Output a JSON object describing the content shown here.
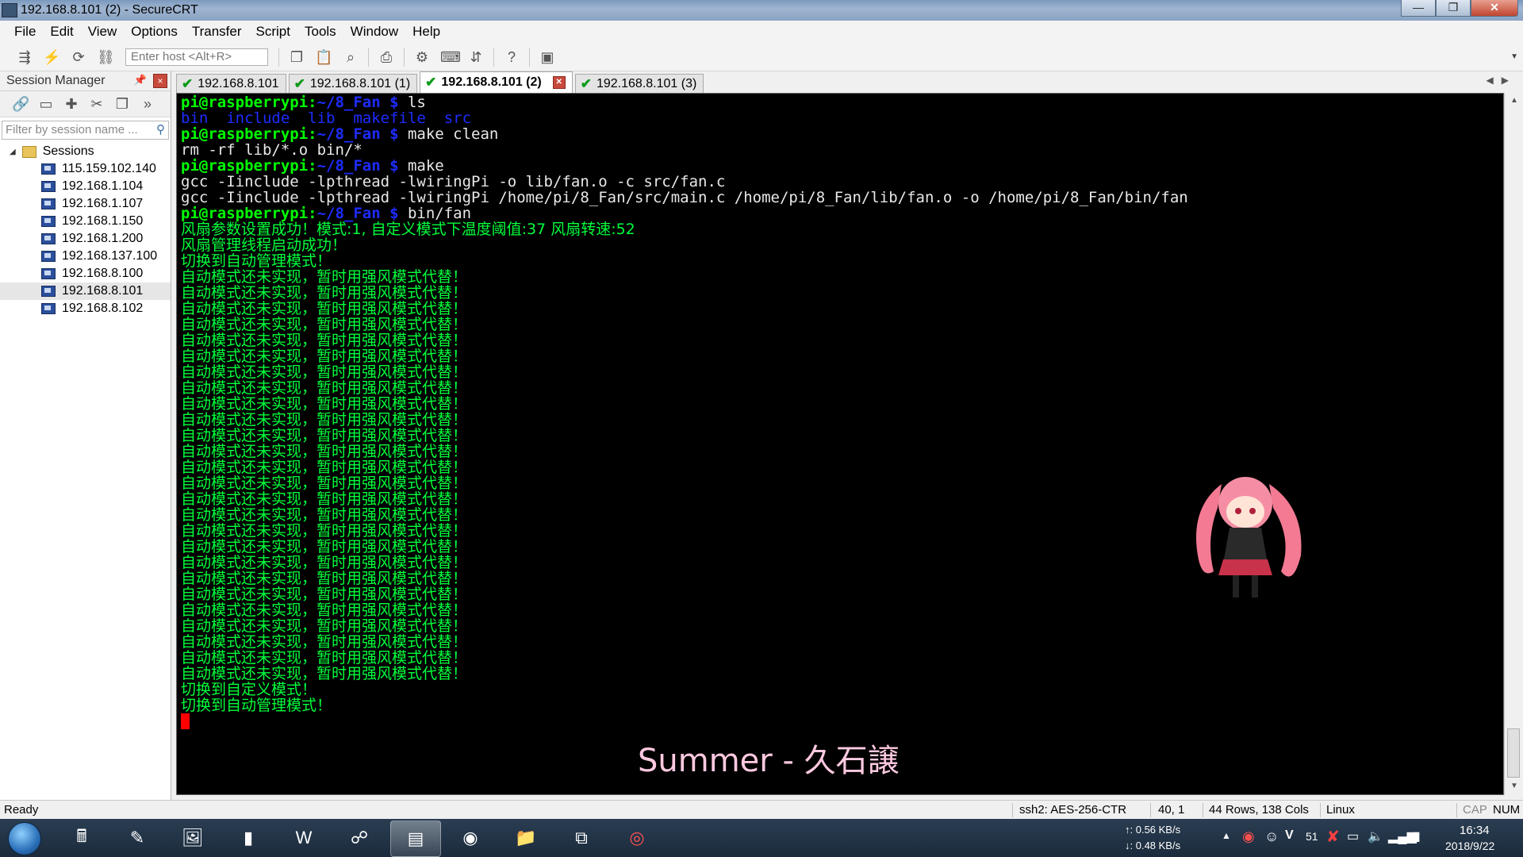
{
  "window": {
    "title": "192.168.8.101 (2) - SecureCRT",
    "controls": [
      "—",
      "❐",
      "✕"
    ]
  },
  "menu": [
    "File",
    "Edit",
    "View",
    "Options",
    "Transfer",
    "Script",
    "Tools",
    "Window",
    "Help"
  ],
  "toolbar": {
    "host_placeholder": "Enter host <Alt+R>",
    "icons": [
      "connect-icon",
      "quick-connect-icon",
      "reconnect-icon",
      "disconnect-icon",
      "copy-icon",
      "paste-icon",
      "find-icon",
      "print-icon",
      "settings-icon",
      "keymap-icon",
      "sftp-icon",
      "help-icon",
      "screenshot-icon"
    ]
  },
  "session_manager": {
    "title": "Session Manager",
    "filter_placeholder": "Filter by session name ...",
    "root": "Sessions",
    "sessions": [
      "115.159.102.140",
      "192.168.1.104",
      "192.168.1.107",
      "192.168.1.150",
      "192.168.1.200",
      "192.168.137.100",
      "192.168.8.100",
      "192.168.8.101",
      "192.168.8.102"
    ],
    "selected": "192.168.8.101"
  },
  "tabs": [
    {
      "label": "192.168.8.101",
      "active": false
    },
    {
      "label": "192.168.8.101 (1)",
      "active": false
    },
    {
      "label": "192.168.8.101 (2)",
      "active": true
    },
    {
      "label": "192.168.8.101 (3)",
      "active": false
    }
  ],
  "terminal": {
    "prompt_user": "pi@raspberrypi:",
    "prompt_path": "~/8_Fan $ ",
    "lines": [
      {
        "type": "prompt",
        "cmd": "ls"
      },
      {
        "type": "ls",
        "text": "bin  include  lib  makefile  src"
      },
      {
        "type": "prompt",
        "cmd": "make clean"
      },
      {
        "type": "out",
        "text": "rm -rf lib/*.o bin/*"
      },
      {
        "type": "prompt",
        "cmd": "make"
      },
      {
        "type": "out",
        "text": "gcc -Iinclude -lpthread -lwiringPi -o lib/fan.o -c src/fan.c"
      },
      {
        "type": "out",
        "text": "gcc -Iinclude -lpthread -lwiringPi /home/pi/8_Fan/src/main.c /home/pi/8_Fan/lib/fan.o -o /home/pi/8_Fan/bin/fan"
      },
      {
        "type": "prompt",
        "cmd": "bin/fan"
      },
      {
        "type": "cjk",
        "text": "风扇参数设置成功！模式:1, 自定义模式下温度阈值:37 风扇转速:52"
      },
      {
        "type": "cjk",
        "text": "风扇管理线程启动成功！"
      },
      {
        "type": "cjk",
        "text": "切换到自动管理模式！"
      },
      {
        "type": "cjk",
        "text": "自动模式还未实现，暂时用强风模式代替！"
      },
      {
        "type": "cjk",
        "text": "自动模式还未实现，暂时用强风模式代替！"
      },
      {
        "type": "cjk",
        "text": "自动模式还未实现，暂时用强风模式代替！"
      },
      {
        "type": "cjk",
        "text": "自动模式还未实现，暂时用强风模式代替！"
      },
      {
        "type": "cjk",
        "text": "自动模式还未实现，暂时用强风模式代替！"
      },
      {
        "type": "cjk",
        "text": "自动模式还未实现，暂时用强风模式代替！"
      },
      {
        "type": "cjk",
        "text": "自动模式还未实现，暂时用强风模式代替！"
      },
      {
        "type": "cjk",
        "text": "自动模式还未实现，暂时用强风模式代替！"
      },
      {
        "type": "cjk",
        "text": "自动模式还未实现，暂时用强风模式代替！"
      },
      {
        "type": "cjk",
        "text": "自动模式还未实现，暂时用强风模式代替！"
      },
      {
        "type": "cjk",
        "text": "自动模式还未实现，暂时用强风模式代替！"
      },
      {
        "type": "cjk",
        "text": "自动模式还未实现，暂时用强风模式代替！"
      },
      {
        "type": "cjk",
        "text": "自动模式还未实现，暂时用强风模式代替！"
      },
      {
        "type": "cjk",
        "text": "自动模式还未实现，暂时用强风模式代替！"
      },
      {
        "type": "cjk",
        "text": "自动模式还未实现，暂时用强风模式代替！"
      },
      {
        "type": "cjk",
        "text": "自动模式还未实现，暂时用强风模式代替！"
      },
      {
        "type": "cjk",
        "text": "自动模式还未实现，暂时用强风模式代替！"
      },
      {
        "type": "cjk",
        "text": "自动模式还未实现，暂时用强风模式代替！"
      },
      {
        "type": "cjk",
        "text": "自动模式还未实现，暂时用强风模式代替！"
      },
      {
        "type": "cjk",
        "text": "自动模式还未实现，暂时用强风模式代替！"
      },
      {
        "type": "cjk",
        "text": "自动模式还未实现，暂时用强风模式代替！"
      },
      {
        "type": "cjk",
        "text": "自动模式还未实现，暂时用强风模式代替！"
      },
      {
        "type": "cjk",
        "text": "自动模式还未实现，暂时用强风模式代替！"
      },
      {
        "type": "cjk",
        "text": "自动模式还未实现，暂时用强风模式代替！"
      },
      {
        "type": "cjk",
        "text": "自动模式还未实现，暂时用强风模式代替！"
      },
      {
        "type": "cjk",
        "text": "自动模式还未实现，暂时用强风模式代替！"
      },
      {
        "type": "cjk",
        "text": "切换到自定义模式！"
      },
      {
        "type": "cjk",
        "text": "切换到自动管理模式！"
      },
      {
        "type": "cursor",
        "text": ""
      }
    ]
  },
  "overlay": {
    "song_title": "Summer - 久石譲"
  },
  "status_bar": {
    "ready": "Ready",
    "cipher": "ssh2: AES-256-CTR",
    "cursor_pos": "40,  1",
    "dimensions": "44 Rows, 138 Cols",
    "os": "Linux",
    "caps": "CAP",
    "num": "NUM"
  },
  "taskbar": {
    "apps": [
      "calculator-icon",
      "notepad-icon",
      "image-viewer-icon",
      "cmd-icon",
      "word-icon",
      "network-icon",
      "securecrt-icon",
      "chrome-icon",
      "explorer-icon",
      "remote-desktop-icon",
      "netease-music-icon"
    ],
    "upload_speed": "↑: 0.56 KB/s",
    "download_speed": "↓: 0.48 KB/s",
    "tray_number": "51",
    "time": "16:34",
    "date": "2018/9/22"
  },
  "colors": {
    "terminal_bg": "#000000",
    "prompt_green": "#00ff00",
    "path_blue": "#1e2cff",
    "output_green": "#00ff3c",
    "cursor_red": "#ff0000",
    "tab_check": "#0c9a1a"
  }
}
